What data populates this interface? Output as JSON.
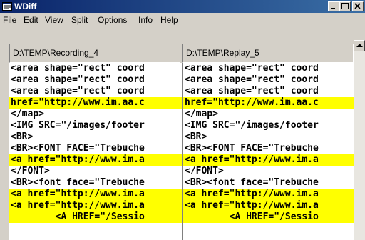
{
  "window": {
    "title": "WDiff"
  },
  "menu": {
    "items": [
      {
        "pre": "",
        "key": "F",
        "post": "ile"
      },
      {
        "pre": "",
        "key": "E",
        "post": "dit"
      },
      {
        "pre": "",
        "key": "V",
        "post": "iew"
      },
      {
        "pre": "",
        "key": "S",
        "post": "plit"
      },
      {
        "pre": "",
        "key": "O",
        "post": "ptions"
      },
      {
        "pre": "",
        "key": "I",
        "post": "nfo"
      },
      {
        "pre": "",
        "key": "H",
        "post": "elp"
      }
    ]
  },
  "paths": {
    "left": "D:\\TEMP\\Recording_4",
    "right": "D:\\TEMP\\Replay_5"
  },
  "colors": {
    "highlight": "#ffff00",
    "titlebar": "#0a246a",
    "face": "#d4d0c8"
  },
  "left_lines": [
    {
      "text": "<area shape=\"rect\" coord",
      "hl": false
    },
    {
      "text": "<area shape=\"rect\" coord",
      "hl": false
    },
    {
      "text": "<area shape=\"rect\" coord",
      "hl": false
    },
    {
      "text": "href=\"http://www.im.aa.c",
      "hl": true
    },
    {
      "text": "</map>",
      "hl": false
    },
    {
      "text": "<IMG SRC=\"/images/footer",
      "hl": false
    },
    {
      "text": "<BR>",
      "hl": false
    },
    {
      "text": "<BR><FONT FACE=\"Trebuche",
      "hl": false
    },
    {
      "text": "<a href=\"http://www.im.a",
      "hl": true
    },
    {
      "text": "</FONT>",
      "hl": false
    },
    {
      "text": "<BR><font face=\"Trebuche",
      "hl": false
    },
    {
      "text": "<a href=\"http://www.im.a",
      "hl": true
    },
    {
      "text": "<a href=\"http://www.im.a",
      "hl": true
    },
    {
      "text": "        <A HREF=\"/Sessio",
      "hl": true
    }
  ],
  "right_lines": [
    {
      "text": "<area shape=\"rect\" coord",
      "hl": false
    },
    {
      "text": "<area shape=\"rect\" coord",
      "hl": false
    },
    {
      "text": "<area shape=\"rect\" coord",
      "hl": false
    },
    {
      "text": "href=\"http://www.im.aa.c",
      "hl": true
    },
    {
      "text": "</map>",
      "hl": false
    },
    {
      "text": "<IMG SRC=\"/images/footer",
      "hl": false
    },
    {
      "text": "<BR>",
      "hl": false
    },
    {
      "text": "<BR><FONT FACE=\"Trebuche",
      "hl": false
    },
    {
      "text": "<a href=\"http://www.im.a",
      "hl": true
    },
    {
      "text": "</FONT>",
      "hl": false
    },
    {
      "text": "<BR><font face=\"Trebuche",
      "hl": false
    },
    {
      "text": "<a href=\"http://www.im.a",
      "hl": true
    },
    {
      "text": "<a href=\"http://www.im.a",
      "hl": true
    },
    {
      "text": "        <A HREF=\"/Sessio",
      "hl": true
    }
  ]
}
